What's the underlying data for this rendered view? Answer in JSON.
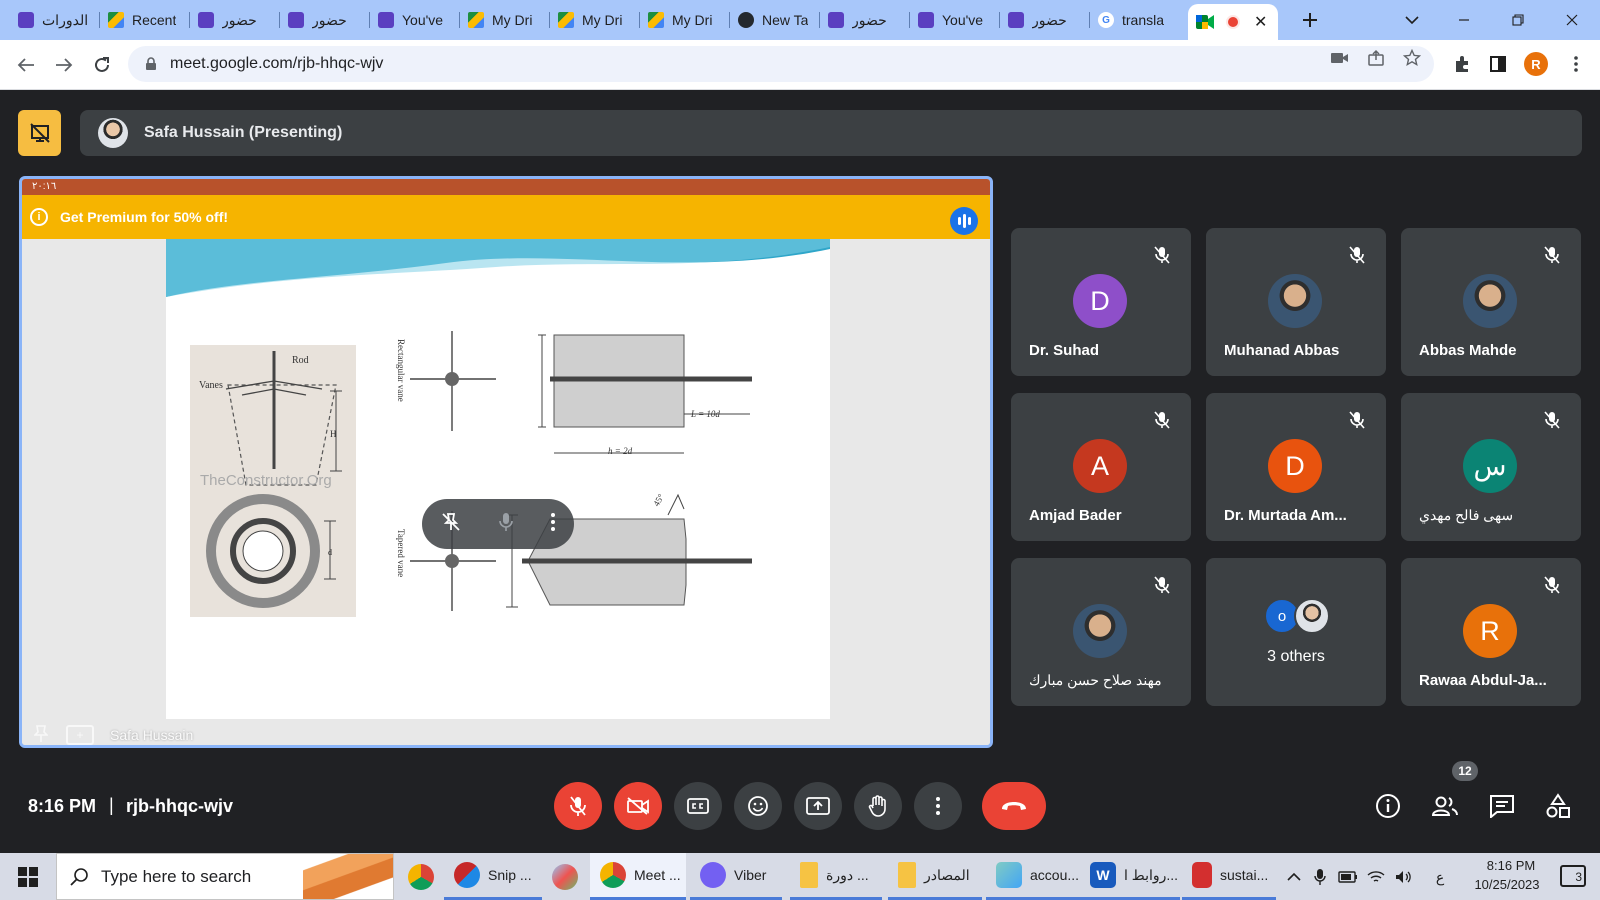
{
  "browser": {
    "tabs": [
      {
        "label": "الدورات",
        "icon": "form-icon"
      },
      {
        "label": "Recent",
        "icon": "drive-icon"
      },
      {
        "label": "حضور",
        "icon": "form-icon"
      },
      {
        "label": "حضور",
        "icon": "form-icon"
      },
      {
        "label": "You've",
        "icon": "form-icon"
      },
      {
        "label": "My Dri",
        "icon": "drive-icon"
      },
      {
        "label": "My Dri",
        "icon": "drive-icon"
      },
      {
        "label": "My Dri",
        "icon": "drive-icon"
      },
      {
        "label": "New Ta",
        "icon": "github-icon"
      },
      {
        "label": "حضور",
        "icon": "form-icon"
      },
      {
        "label": "You've",
        "icon": "form-icon"
      },
      {
        "label": "حضور",
        "icon": "form-icon"
      },
      {
        "label": "transla",
        "icon": "google-icon"
      }
    ],
    "active_tab": {
      "icon": "meet-icon",
      "recording": true
    },
    "url": "meet.google.com/rjb-hhqc-wjv",
    "profile_initial": "R"
  },
  "meet": {
    "presenter_label": "Safa Hussain (Presenting)",
    "premium_banner": "Get Premium for 50% off!",
    "phone_status_time": "٢٠:١٦",
    "screen_owner": "Safa Hussain",
    "participants": [
      {
        "name": "Dr. Suhad",
        "initial": "D",
        "color": "#8e4fc9",
        "photo": false
      },
      {
        "name": "Muhanad Abbas",
        "initial": "",
        "color": "",
        "photo": true
      },
      {
        "name": "Abbas Mahde",
        "initial": "",
        "color": "",
        "photo": true
      },
      {
        "name": "Amjad Bader",
        "initial": "A",
        "color": "#c5381f",
        "photo": false
      },
      {
        "name": "Dr. Murtada Am...",
        "initial": "D",
        "color": "#e8530e",
        "photo": false
      },
      {
        "name": "سهى فالح مهدي",
        "initial": "س",
        "color": "#0b8474",
        "photo": false
      },
      {
        "name": "مهند صلاح حسن مبارك",
        "initial": "",
        "color": "",
        "photo": true
      },
      {
        "name": "Rawaa Abdul-Ja...",
        "initial": "R",
        "color": "#e8710a",
        "photo": false
      }
    ],
    "others": {
      "label": "3 others",
      "avatar_initial": "o"
    },
    "clock": "8:16 PM",
    "separator": "|",
    "meeting_code": "rjb-hhqc-wjv",
    "people_count": "12"
  },
  "slide": {
    "figure_labels": {
      "rod": "Rod",
      "vanes": "Vanes",
      "h": "H",
      "d": "d",
      "watermark": "TheConstructor.Org",
      "rectangular_vane": "Rectangular vane",
      "tapered_vane": "Tapered vane",
      "l_eq": "L = 10d",
      "h_eq": "h = 2d",
      "angle": "45°"
    }
  },
  "taskbar": {
    "search_placeholder": "Type here to search",
    "items": [
      {
        "label": "",
        "icon": "chrome-icon"
      },
      {
        "label": "Snip ...",
        "icon": "snip-icon"
      },
      {
        "label": "",
        "icon": "paint-icon"
      },
      {
        "label": "Meet ...",
        "icon": "chrome-icon"
      },
      {
        "label": "Viber",
        "icon": "viber-icon"
      },
      {
        "label": "دورة ...",
        "icon": "folder-icon"
      },
      {
        "label": "المصادر",
        "icon": "folder-icon"
      },
      {
        "label": "accou...",
        "icon": "app-icon"
      },
      {
        "label": "روابط ا...",
        "icon": "word-icon"
      },
      {
        "label": "sustai...",
        "icon": "pdf-icon"
      }
    ],
    "lang": "ع",
    "time": "8:16 PM",
    "date": "10/25/2023",
    "notifications": "3"
  }
}
